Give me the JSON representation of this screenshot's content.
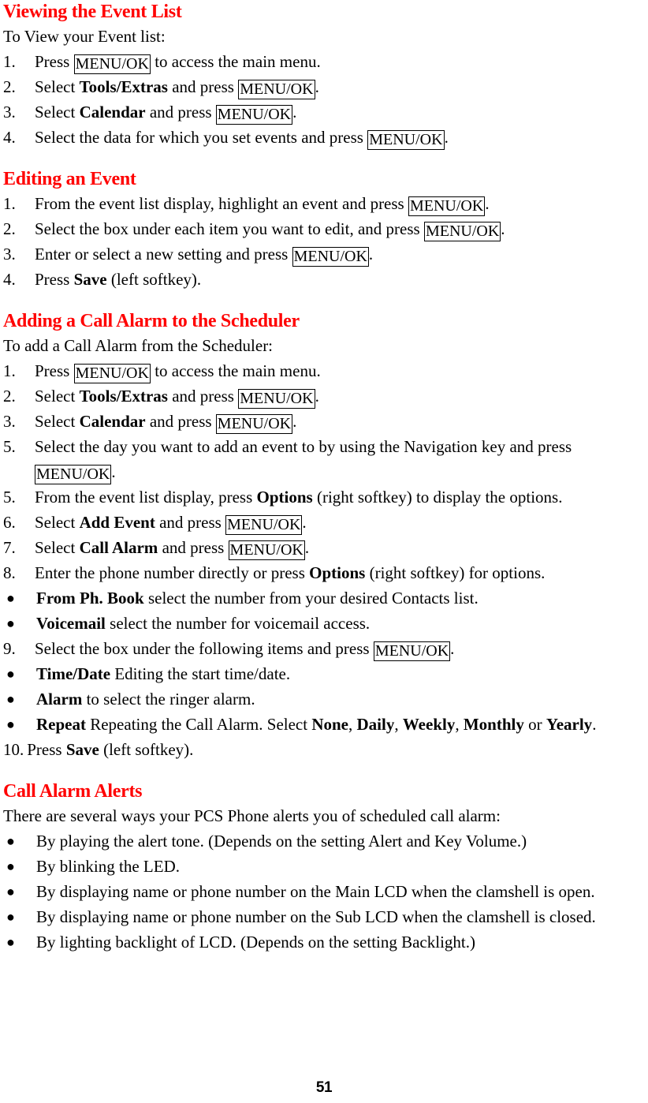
{
  "document": {
    "page_number": "51",
    "heading_color": "#ff0000",
    "body_color": "#000000"
  },
  "sections": {
    "viewing_event_list": {
      "heading": "Viewing the Event List",
      "intro": "To View your Event list:",
      "steps": [
        {
          "marker": "1.",
          "pre": "Press ",
          "key": "MENU/OK",
          "post": " to access the main menu."
        },
        {
          "marker": "2.",
          "pre": "Select ",
          "bold": "Tools/Extras",
          "mid": " and press ",
          "key": "MENU/OK",
          "post": "."
        },
        {
          "marker": "3.",
          "pre": "Select ",
          "bold": "Calendar",
          "mid": " and press ",
          "key": "MENU/OK",
          "post": "."
        },
        {
          "marker": "4.",
          "pre": "Select the data for which you set events and press ",
          "key": "MENU/OK",
          "post": "."
        }
      ]
    },
    "editing_event": {
      "heading": "Editing an Event",
      "steps": [
        {
          "marker": "1.",
          "pre": "From the event list display, highlight an event and press ",
          "key": "MENU/OK",
          "post": "."
        },
        {
          "marker": "2.",
          "pre": "Select the box under each item you want to edit, and press ",
          "key": "MENU/OK",
          "post": "."
        },
        {
          "marker": "3.",
          "pre": "Enter or select a new setting and press ",
          "key": "MENU/OK",
          "post": "."
        },
        {
          "marker": "4.",
          "pre": "Press ",
          "bold": "Save",
          "mid": " (left softkey).",
          "post": ""
        }
      ]
    },
    "adding_call_alarm": {
      "heading": "Adding a Call Alarm to the Scheduler",
      "intro": "To add a Call Alarm from the Scheduler:",
      "steps": [
        {
          "marker": "1.",
          "pre": "Press ",
          "key": "MENU/OK",
          "post": " to access the main menu."
        },
        {
          "marker": "2.",
          "pre": "Select ",
          "bold": "Tools/Extras",
          "mid": " and press ",
          "key": "MENU/OK",
          "post": "."
        },
        {
          "marker": "3.",
          "pre": "Select ",
          "bold": "Calendar",
          "mid": " and press ",
          "key": "MENU/OK",
          "post": "."
        },
        {
          "marker": "5.",
          "pre": "Select the day you want to add an event to by using the Navigation key and press ",
          "key": "MENU/OK",
          "post": "."
        },
        {
          "marker": "5.",
          "pre": "From the event list display, press ",
          "bold": "Options",
          "mid": " (right softkey) to display the options.",
          "post": ""
        },
        {
          "marker": "6.",
          "pre": "Select ",
          "bold": "Add Event",
          "mid": " and press ",
          "key": "MENU/OK",
          "post": "."
        },
        {
          "marker": "7.",
          "pre": "Select ",
          "bold": "Call Alarm",
          "mid": " and press ",
          "key": "MENU/OK",
          "post": "."
        },
        {
          "marker": "8.",
          "pre": "Enter the phone number directly or press ",
          "bold": "Options",
          "mid": " (right softkey) for options.",
          "post": ""
        }
      ],
      "options_bullets": [
        {
          "bold": "From Ph. Book",
          "text": " select the number from your desired Contacts list."
        },
        {
          "bold": "Voicemail",
          "text": " select the number for voicemail access."
        }
      ],
      "step9": {
        "marker": "9.",
        "pre": "Select the box under the following items and press ",
        "key": "MENU/OK",
        "post": "."
      },
      "item_bullets": [
        {
          "bold": "Time/Date",
          "text": " Editing the start time/date."
        },
        {
          "bold": "Alarm",
          "text": " to select the ringer alarm."
        }
      ],
      "repeat_bullet": {
        "bold": "Repeat",
        "text": " Repeating the Call Alarm. Select ",
        "options": [
          "None",
          "Daily",
          "Weekly",
          "Monthly",
          "Yearly"
        ],
        "separator": ", ",
        "conjunction": " or ",
        "tail": "."
      },
      "step10": {
        "marker": "10.",
        "pre": "Press ",
        "bold": "Save",
        "post": " (left softkey)."
      }
    },
    "call_alarm_alerts": {
      "heading": "Call Alarm Alerts",
      "intro": "There are several ways your PCS Phone alerts you of scheduled call alarm:",
      "bullets": [
        "By playing the alert tone. (Depends on the setting Alert and Key Volume.)",
        "By blinking the LED.",
        "By displaying name or phone number on the Main LCD when the clamshell is open.",
        "By displaying name or phone number on the Sub LCD when the clamshell is closed.",
        "By lighting backlight of LCD. (Depends on the setting Backlight.)"
      ],
      "bullet_glyph": "●"
    }
  }
}
